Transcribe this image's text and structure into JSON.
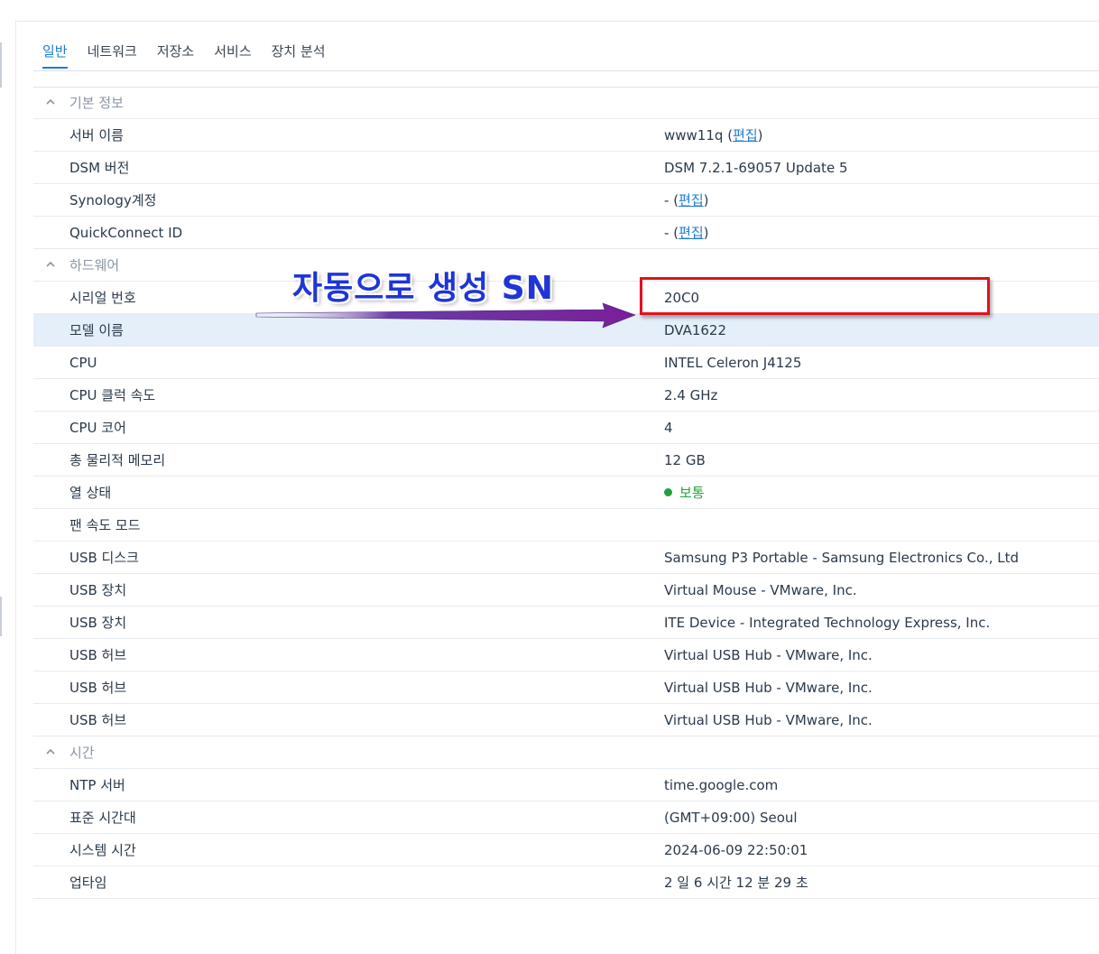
{
  "tabs": [
    {
      "label": "일반",
      "active": true
    },
    {
      "label": "네트워크",
      "active": false
    },
    {
      "label": "저장소",
      "active": false
    },
    {
      "label": "서비스",
      "active": false
    },
    {
      "label": "장치 분석",
      "active": false
    }
  ],
  "sections": {
    "basic": {
      "title": "기본 정보",
      "server_name": {
        "label": "서버 이름",
        "value": "www11q",
        "link": "편집"
      },
      "dsm_version": {
        "label": "DSM 버전",
        "value": "DSM 7.2.1-69057 Update 5"
      },
      "synology_account": {
        "label": "Synology계정",
        "value": "-",
        "link": "편집"
      },
      "quickconnect": {
        "label": "QuickConnect ID",
        "value": "-",
        "link": "편집"
      }
    },
    "hardware": {
      "title": "하드웨어",
      "rows": [
        {
          "label": "시리얼 번호",
          "value": "20C0"
        },
        {
          "label": "모델 이름",
          "value": "DVA1622"
        },
        {
          "label": "CPU",
          "value": "INTEL Celeron J4125"
        },
        {
          "label": "CPU 클럭 속도",
          "value": "2.4 GHz"
        },
        {
          "label": "CPU 코어",
          "value": "4"
        },
        {
          "label": "총 물리적 메모리",
          "value": "12 GB"
        },
        {
          "label": "열 상태",
          "value": "보통"
        },
        {
          "label": "팬 속도 모드",
          "value": ""
        },
        {
          "label": "USB 디스크",
          "value": "Samsung P3 Portable - Samsung Electronics Co., Ltd"
        },
        {
          "label": "USB 장치",
          "value": "Virtual Mouse - VMware, Inc."
        },
        {
          "label": "USB 장치",
          "value": "ITE Device - Integrated Technology Express, Inc."
        },
        {
          "label": "USB 허브",
          "value": "Virtual USB Hub - VMware, Inc."
        },
        {
          "label": "USB 허브",
          "value": "Virtual USB Hub - VMware, Inc."
        },
        {
          "label": "USB 허브",
          "value": "Virtual USB Hub - VMware, Inc."
        }
      ]
    },
    "time": {
      "title": "시간",
      "rows": [
        {
          "label": "NTP 서버",
          "value": "time.google.com"
        },
        {
          "label": "표준 시간대",
          "value": "(GMT+09:00) Seoul"
        },
        {
          "label": "시스템 시간",
          "value": "2024-06-09 22:50:01"
        },
        {
          "label": "업타임",
          "value": "2 일 6 시간 12 분 29 초"
        }
      ]
    }
  },
  "annotation": {
    "text": "자동으로 생성 SN"
  },
  "colors": {
    "accent": "#1f7bd1",
    "status_ok": "#23a13a",
    "highlight": "#e4effa",
    "annotation": "#1f35d8",
    "red_box": "#e0121c"
  }
}
